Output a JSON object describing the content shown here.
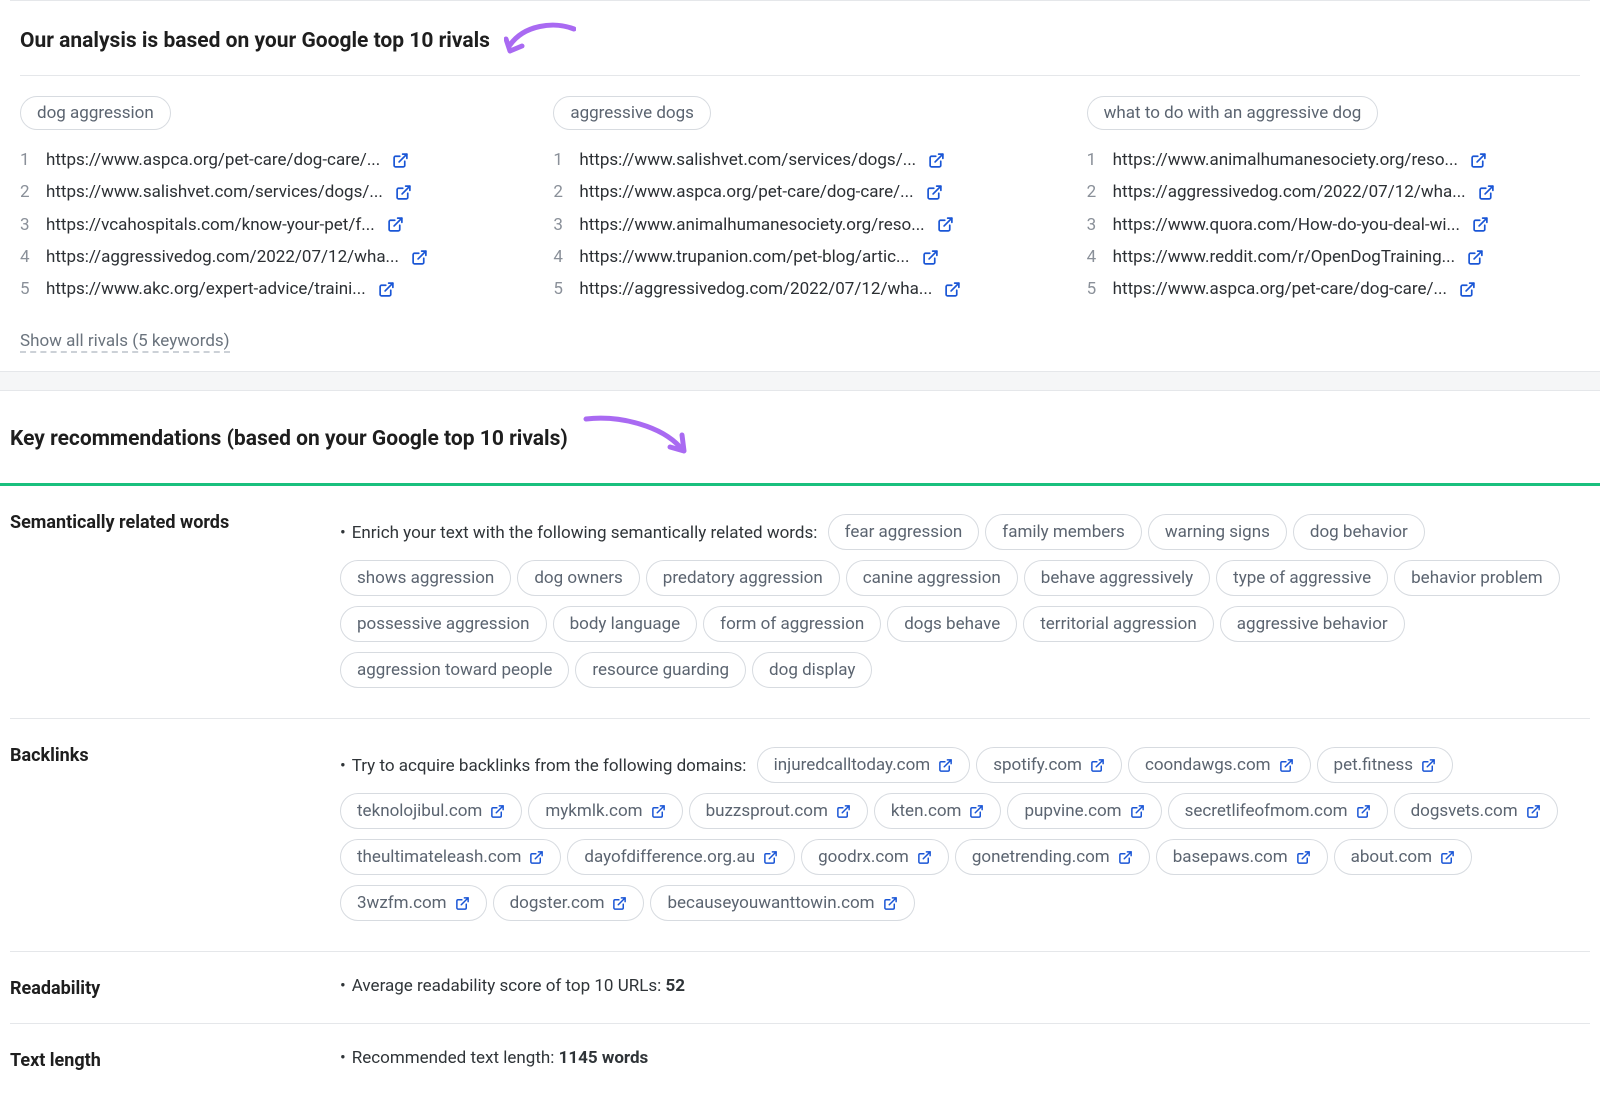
{
  "analysis": {
    "heading": "Our analysis is based on your Google top 10 rivals",
    "columns": [
      {
        "keyword": "dog aggression",
        "urls": [
          "https://www.aspca.org/pet-care/dog-care/...",
          "https://www.salishvet.com/services/dogs/...",
          "https://vcahospitals.com/know-your-pet/f...",
          "https://aggressivedog.com/2022/07/12/wha...",
          "https://www.akc.org/expert-advice/traini..."
        ]
      },
      {
        "keyword": "aggressive dogs",
        "urls": [
          "https://www.salishvet.com/services/dogs/...",
          "https://www.aspca.org/pet-care/dog-care/...",
          "https://www.animalhumanesociety.org/reso...",
          "https://www.trupanion.com/pet-blog/artic...",
          "https://aggressivedog.com/2022/07/12/wha..."
        ]
      },
      {
        "keyword": "what to do with an aggressive dog",
        "urls": [
          "https://www.animalhumanesociety.org/reso...",
          "https://aggressivedog.com/2022/07/12/wha...",
          "https://www.quora.com/How-do-you-deal-wi...",
          "https://www.reddit.com/r/OpenDogTraining...",
          "https://www.aspca.org/pet-care/dog-care/..."
        ]
      }
    ],
    "show_all": "Show all rivals (5 keywords)"
  },
  "recs": {
    "heading": "Key recommendations (based on your Google top 10 rivals)",
    "semantic": {
      "label": "Semantically related words",
      "lead": "Enrich your text with the following semantically related words:",
      "chips": [
        "fear aggression",
        "family members",
        "warning signs",
        "dog behavior",
        "shows aggression",
        "dog owners",
        "predatory aggression",
        "canine aggression",
        "behave aggressively",
        "type of aggressive",
        "behavior problem",
        "possessive aggression",
        "body language",
        "form of aggression",
        "dogs behave",
        "territorial aggression",
        "aggressive behavior",
        "aggression toward people",
        "resource guarding",
        "dog display"
      ]
    },
    "backlinks": {
      "label": "Backlinks",
      "lead": "Try to acquire backlinks from the following domains:",
      "chips": [
        "injuredcalltoday.com",
        "spotify.com",
        "coondawgs.com",
        "pet.fitness",
        "teknolojibul.com",
        "mykmlk.com",
        "buzzsprout.com",
        "kten.com",
        "pupvine.com",
        "secretlifeofmom.com",
        "dogsvets.com",
        "theultimateleash.com",
        "dayofdifference.org.au",
        "goodrx.com",
        "gonetrending.com",
        "basepaws.com",
        "about.com",
        "3wzfm.com",
        "dogster.com",
        "becauseyouwanttowin.com"
      ]
    },
    "readability": {
      "label": "Readability",
      "text_pre": "Average readability score of top 10 URLs: ",
      "value": "52"
    },
    "textlength": {
      "label": "Text length",
      "text_pre": "Recommended text length: ",
      "value": "1145 words"
    }
  }
}
